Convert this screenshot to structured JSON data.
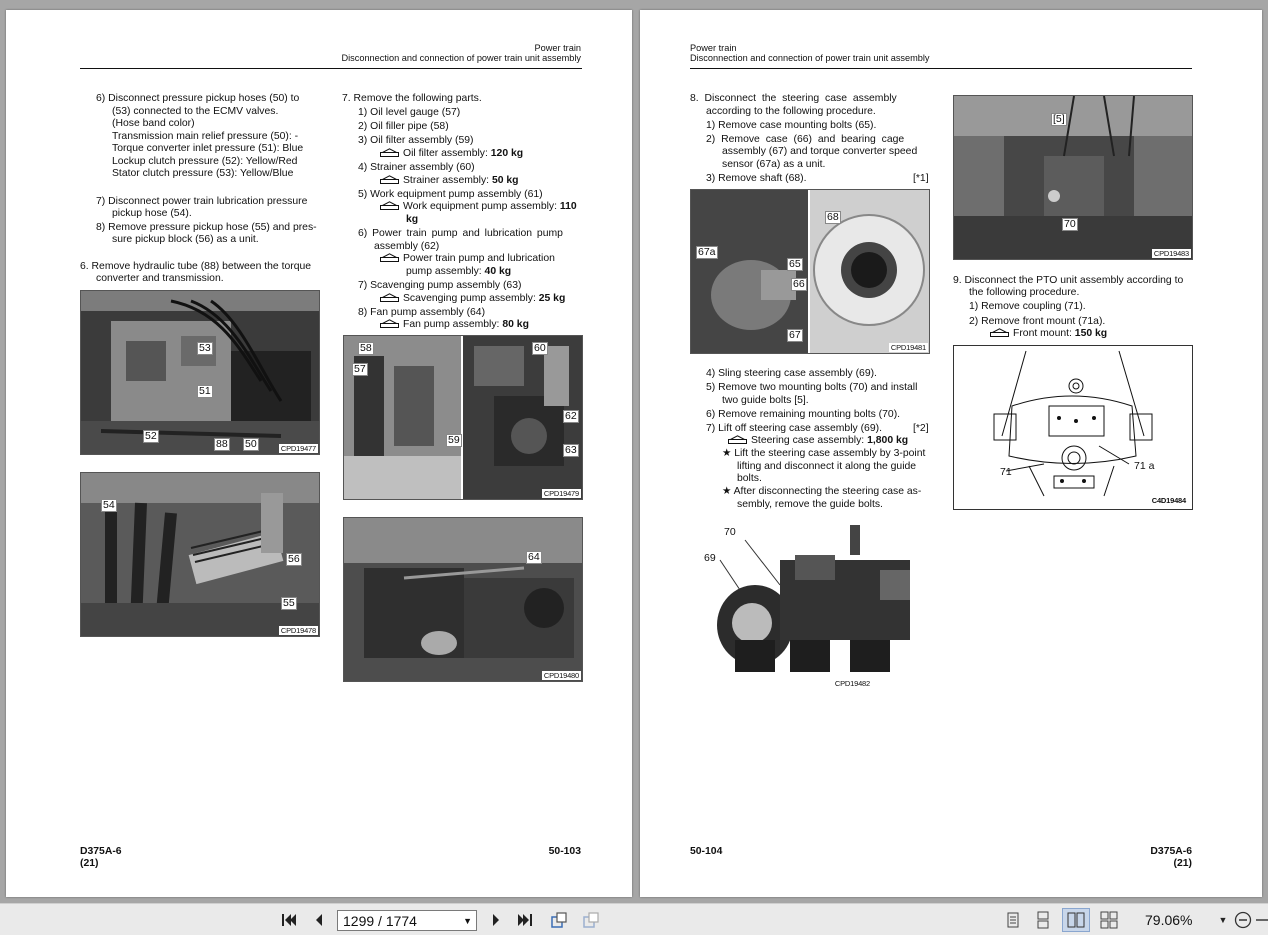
{
  "left_page": {
    "header_section": "Power train",
    "header_title": "Disconnection and connection of power train unit assembly",
    "col1": [
      "6)  Disconnect pressure pickup hoses (50) to",
      "(53) connected to the ECMV valves.",
      "(Hose band color)",
      "Transmission main relief pressure (50): -",
      "Torque converter inlet pressure (51): Blue",
      "Lockup clutch pressure (52): Yellow/Red",
      "Stator clutch pressure (53): Yellow/Blue",
      "7)  Disconnect power train lubrication pressure",
      "pickup hose (54).",
      "8)  Remove pressure pickup hose (55) and pres-",
      "sure pickup block (56) as a unit.",
      "6.  Remove hydraulic tube (88) between the torque",
      "converter and transmission."
    ],
    "col2": [
      "7.  Remove the following parts.",
      "1)  Oil level gauge (57)",
      "2)  Oil filler pipe (58)",
      "3)  Oil filter assembly (59)",
      "Oil filter assembly: ",
      "120 kg",
      "4)  Strainer assembly (60)",
      "Strainer assembly: ",
      "50 kg",
      "5)  Work equipment pump assembly (61)",
      "Work equipment pump assembly: ",
      "110",
      "kg",
      "6)  Power train pump and lubrication pump",
      "assembly (62)",
      "Power train pump and lubrication",
      "pump assembly: ",
      "40 kg",
      "7)  Scavenging pump assembly (63)",
      "Scavenging pump assembly: ",
      "25 kg",
      "8)  Fan pump assembly (64)",
      "Fan pump assembly: ",
      "80 kg"
    ],
    "photo_labels": {
      "p477": [
        "53",
        "51",
        "52",
        "88",
        "50"
      ],
      "p478": [
        "54",
        "56",
        "55"
      ],
      "p479": [
        "58",
        "57",
        "59",
        "60",
        "62",
        "63"
      ],
      "p480": [
        "64"
      ]
    },
    "captions": [
      "CPD19477",
      "CPD19478",
      "CPD19479",
      "CPD19480"
    ],
    "footer_model": "D375A-6",
    "footer_rev": "(21)",
    "footer_page": "50-103"
  },
  "right_page": {
    "header_section": "Power train",
    "header_title": "Disconnection and connection of power train unit assembly",
    "col1_top": [
      "8.  Disconnect  the  steering  case  assembly",
      "according to the following procedure.",
      "1)  Remove case mounting bolts (65).",
      "2)  Remove  case  (66)  and  bearing  cage",
      "assembly (67) and torque converter speed",
      "sensor (67a) as a unit.",
      "3)  Remove shaft (68).",
      "[*1]"
    ],
    "col1_bottom": [
      "4)  Sling steering case assembly (69).",
      "5)  Remove two mounting bolts (70) and install",
      "two guide bolts [5].",
      "6)  Remove remaining mounting bolts (70).",
      "7)  Lift off steering case assembly (69).",
      "[*2]",
      "Steering case assembly: ",
      "1,800 kg",
      "★  Lift the steering case assembly by 3-point",
      "lifting and disconnect it along the guide",
      "bolts.",
      "★  After disconnecting the steering case as-",
      "sembly, remove the guide bolts."
    ],
    "col2": [
      "9.  Disconnect the PTO unit assembly according to",
      "the following procedure.",
      "1)  Remove coupling (71).",
      "2)  Remove front mount (71a).",
      "Front mount: ",
      "150 kg"
    ],
    "photo_labels": {
      "p481": [
        "67a",
        "65",
        "66",
        "67",
        "68"
      ],
      "p483": [
        "[5]",
        "70"
      ],
      "p482": [
        "70",
        "69"
      ],
      "d484": [
        "71",
        "71 a"
      ]
    },
    "captions": [
      "CPD19481",
      "CPD19483",
      "CPD19482",
      "C4D19484"
    ],
    "footer_page": "50-104",
    "footer_model": "D375A-6",
    "footer_rev": "(21)"
  },
  "toolbar": {
    "page_indicator": "1299 / 1774",
    "zoom": "79.06%",
    "icons": [
      "first-page-icon",
      "previous-page-icon",
      "next-page-icon",
      "last-page-icon",
      "rotate-icon",
      "fit-page-icon",
      "single-page-view-icon",
      "continuous-view-icon",
      "two-page-view-icon",
      "two-page-continuous-view-icon",
      "zoom-out-icon"
    ]
  }
}
